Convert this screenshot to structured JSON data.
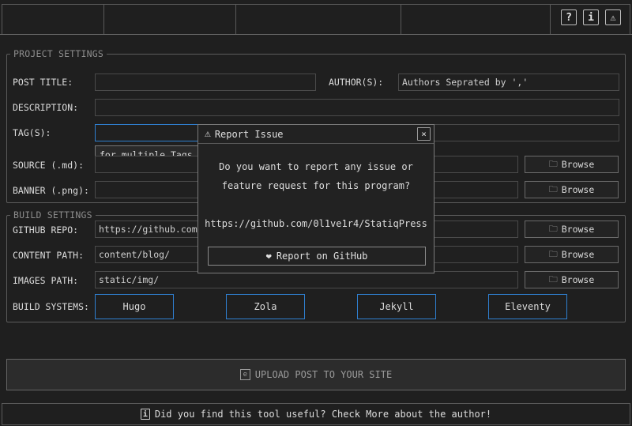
{
  "toolbar": {
    "help_icon_glyph": "?",
    "info_icon_glyph": "i",
    "warning_icon_glyph": "⚠"
  },
  "project_settings": {
    "legend": "PROJECT SETTINGS",
    "post_title_label": "POST TITLE:",
    "post_title_value": "",
    "authors_label": "AUTHOR(S):",
    "authors_placeholder": "Authors Seprated by ','",
    "description_label": "DESCRIPTION:",
    "description_value": "",
    "tags_label": "TAG(S):",
    "tags_value": "",
    "tags_tooltip": "for multiple Tags, se",
    "source_label": "SOURCE (.md):",
    "banner_label": "BANNER (.png):",
    "browse_label": "Browse"
  },
  "build_settings": {
    "legend": "BUILD SETTINGS",
    "github_repo_label": "GITHUB REPO:",
    "github_repo_value": "https://github.com/Di",
    "content_path_label": "CONTENT PATH:",
    "content_path_value": "content/blog/",
    "images_path_label": "IMAGES PATH:",
    "images_path_value": "static/img/",
    "build_systems_label": "BUILD SYSTEMS:",
    "systems": [
      "Hugo",
      "Zola",
      "Jekyll",
      "Eleventy"
    ],
    "browse_label": "Browse"
  },
  "upload": {
    "label": "UPLOAD POST TO YOUR SITE"
  },
  "footer": {
    "text": "Did you find this tool useful? Check More about the author!"
  },
  "modal": {
    "title": "Report Issue",
    "close_glyph": "×",
    "line1": "Do you want to report any issue or",
    "line2": "feature request for this program?",
    "url": "https://github.com/0l1ve1r4/StatiqPress",
    "button_label": "Report on GitHub",
    "button_glyph": "❤"
  },
  "colors": {
    "background": "#1f1f1f",
    "accent_blue": "#2f7fd0",
    "text": "#d6d6d6"
  }
}
